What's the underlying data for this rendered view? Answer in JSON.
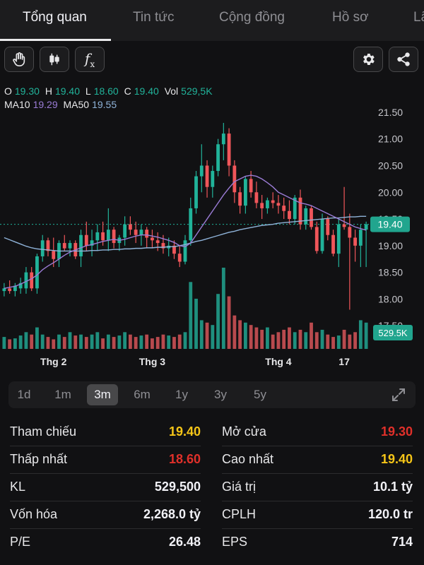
{
  "tabs": [
    {
      "label": "Tổng quan",
      "active": true
    },
    {
      "label": "Tin tức",
      "active": false
    },
    {
      "label": "Cộng đồng",
      "active": false
    },
    {
      "label": "Hồ sơ",
      "active": false
    },
    {
      "label": "Lã",
      "active": false
    }
  ],
  "toolbar": {
    "left_icons": [
      "hand-icon",
      "candlestick-icon",
      "function-fx-icon"
    ],
    "fx_glyph": "f",
    "fx_sub": "x",
    "right_icons": [
      "gear-icon",
      "share-icon"
    ]
  },
  "ohlc": {
    "o_label": "O",
    "o": "19.30",
    "h_label": "H",
    "h": "19.40",
    "l_label": "L",
    "l": "18.60",
    "c_label": "C",
    "c": "19.40",
    "vol_label": "Vol",
    "vol": "529,5K",
    "ma10_label": "MA10",
    "ma10": "19.29",
    "ma50_label": "MA50",
    "ma50": "19.55"
  },
  "chart_data": {
    "type": "candlestick",
    "y_ticks": [
      "21.50",
      "21.00",
      "20.50",
      "20.00",
      "19.50",
      "19.00",
      "18.50",
      "18.00",
      "17.50"
    ],
    "ylim": [
      17.45,
      21.75
    ],
    "x_labels": [
      "Thg 2",
      "Thg 3",
      "Thg 4",
      "17"
    ],
    "last_price_label": "19.40",
    "last_price": 19.4,
    "volume_label": "529.5K",
    "colors": {
      "up": "#21b39a",
      "down": "#f0565a",
      "ma10": "#9b7cd6",
      "ma50": "#8fb3d9",
      "volume_up": "#1f8f7e",
      "volume_down": "#b84a4e"
    },
    "candles": [
      {
        "o": 18.15,
        "h": 18.3,
        "l": 18.05,
        "c": 18.2,
        "v": 0.25
      },
      {
        "o": 18.2,
        "h": 18.35,
        "l": 18.1,
        "c": 18.15,
        "v": 0.2
      },
      {
        "o": 18.15,
        "h": 18.3,
        "l": 18.05,
        "c": 18.25,
        "v": 0.22
      },
      {
        "o": 18.2,
        "h": 18.4,
        "l": 18.1,
        "c": 18.3,
        "v": 0.28
      },
      {
        "o": 18.2,
        "h": 18.6,
        "l": 18.1,
        "c": 18.5,
        "v": 0.35
      },
      {
        "o": 18.5,
        "h": 18.6,
        "l": 18.15,
        "c": 18.2,
        "v": 0.3
      },
      {
        "o": 18.2,
        "h": 18.85,
        "l": 18.1,
        "c": 18.8,
        "v": 0.45
      },
      {
        "o": 18.8,
        "h": 19.2,
        "l": 18.7,
        "c": 19.1,
        "v": 0.3
      },
      {
        "o": 19.1,
        "h": 19.15,
        "l": 18.8,
        "c": 18.9,
        "v": 0.25
      },
      {
        "o": 18.9,
        "h": 19.15,
        "l": 18.6,
        "c": 18.75,
        "v": 0.2
      },
      {
        "o": 18.75,
        "h": 19.1,
        "l": 18.6,
        "c": 19.05,
        "v": 0.3
      },
      {
        "o": 19.05,
        "h": 19.2,
        "l": 18.9,
        "c": 18.95,
        "v": 0.25
      },
      {
        "o": 18.95,
        "h": 19.1,
        "l": 18.8,
        "c": 19.05,
        "v": 0.35
      },
      {
        "o": 19.05,
        "h": 19.1,
        "l": 18.75,
        "c": 18.8,
        "v": 0.28
      },
      {
        "o": 18.8,
        "h": 19.3,
        "l": 18.6,
        "c": 19.2,
        "v": 0.3
      },
      {
        "o": 19.2,
        "h": 19.45,
        "l": 18.9,
        "c": 19.0,
        "v": 0.25
      },
      {
        "o": 19.0,
        "h": 19.3,
        "l": 18.8,
        "c": 19.1,
        "v": 0.3
      },
      {
        "o": 19.1,
        "h": 19.4,
        "l": 18.9,
        "c": 19.25,
        "v": 0.35
      },
      {
        "o": 19.25,
        "h": 19.45,
        "l": 19.0,
        "c": 19.1,
        "v": 0.22
      },
      {
        "o": 19.1,
        "h": 19.7,
        "l": 18.9,
        "c": 19.3,
        "v": 0.3
      },
      {
        "o": 19.3,
        "h": 19.35,
        "l": 18.95,
        "c": 19.05,
        "v": 0.25
      },
      {
        "o": 19.05,
        "h": 19.2,
        "l": 18.9,
        "c": 19.15,
        "v": 0.28
      },
      {
        "o": 19.15,
        "h": 19.55,
        "l": 19.0,
        "c": 19.4,
        "v": 0.35
      },
      {
        "o": 19.4,
        "h": 19.55,
        "l": 19.2,
        "c": 19.3,
        "v": 0.3
      },
      {
        "o": 19.3,
        "h": 19.45,
        "l": 19.05,
        "c": 19.2,
        "v": 0.25
      },
      {
        "o": 19.2,
        "h": 19.4,
        "l": 19.0,
        "c": 19.3,
        "v": 0.28
      },
      {
        "o": 19.3,
        "h": 19.35,
        "l": 18.95,
        "c": 19.15,
        "v": 0.3
      },
      {
        "o": 19.15,
        "h": 19.3,
        "l": 18.95,
        "c": 19.1,
        "v": 0.22
      },
      {
        "o": 19.1,
        "h": 19.25,
        "l": 18.9,
        "c": 19.05,
        "v": 0.25
      },
      {
        "o": 19.05,
        "h": 19.2,
        "l": 18.85,
        "c": 18.95,
        "v": 0.3
      },
      {
        "o": 18.95,
        "h": 19.15,
        "l": 18.8,
        "c": 19.0,
        "v": 0.28
      },
      {
        "o": 19.0,
        "h": 19.1,
        "l": 18.75,
        "c": 18.85,
        "v": 0.25
      },
      {
        "o": 18.85,
        "h": 19.0,
        "l": 18.6,
        "c": 18.7,
        "v": 0.3
      },
      {
        "o": 18.7,
        "h": 19.2,
        "l": 18.65,
        "c": 19.1,
        "v": 0.35
      },
      {
        "o": 19.1,
        "h": 19.9,
        "l": 19.0,
        "c": 19.7,
        "v": 1.4
      },
      {
        "o": 19.7,
        "h": 20.4,
        "l": 19.6,
        "c": 20.3,
        "v": 1.05
      },
      {
        "o": 20.3,
        "h": 20.9,
        "l": 20.0,
        "c": 20.5,
        "v": 0.6
      },
      {
        "o": 20.5,
        "h": 20.6,
        "l": 19.9,
        "c": 20.1,
        "v": 0.55
      },
      {
        "o": 20.1,
        "h": 20.5,
        "l": 19.9,
        "c": 20.4,
        "v": 0.5
      },
      {
        "o": 20.4,
        "h": 21.0,
        "l": 20.3,
        "c": 20.9,
        "v": 1.15
      },
      {
        "o": 20.9,
        "h": 21.3,
        "l": 20.6,
        "c": 21.1,
        "v": 1.7
      },
      {
        "o": 21.1,
        "h": 21.2,
        "l": 20.3,
        "c": 20.5,
        "v": 1.1
      },
      {
        "o": 20.5,
        "h": 20.6,
        "l": 19.8,
        "c": 20.0,
        "v": 0.7
      },
      {
        "o": 20.0,
        "h": 20.1,
        "l": 19.6,
        "c": 19.75,
        "v": 0.6
      },
      {
        "o": 19.75,
        "h": 20.3,
        "l": 19.6,
        "c": 20.25,
        "v": 0.55
      },
      {
        "o": 20.25,
        "h": 20.4,
        "l": 19.9,
        "c": 20.0,
        "v": 0.5
      },
      {
        "o": 20.0,
        "h": 20.2,
        "l": 19.7,
        "c": 19.8,
        "v": 0.45
      },
      {
        "o": 19.8,
        "h": 19.95,
        "l": 19.5,
        "c": 19.7,
        "v": 0.4
      },
      {
        "o": 19.7,
        "h": 19.9,
        "l": 19.6,
        "c": 19.85,
        "v": 0.45
      },
      {
        "o": 19.85,
        "h": 20.0,
        "l": 19.7,
        "c": 19.8,
        "v": 0.3
      },
      {
        "o": 19.8,
        "h": 19.95,
        "l": 19.6,
        "c": 19.75,
        "v": 0.35
      },
      {
        "o": 19.75,
        "h": 19.9,
        "l": 19.5,
        "c": 19.65,
        "v": 0.4
      },
      {
        "o": 19.65,
        "h": 19.85,
        "l": 19.4,
        "c": 19.5,
        "v": 0.45
      },
      {
        "o": 19.5,
        "h": 19.95,
        "l": 19.4,
        "c": 19.9,
        "v": 0.35
      },
      {
        "o": 19.9,
        "h": 20.05,
        "l": 19.3,
        "c": 19.4,
        "v": 0.4
      },
      {
        "o": 19.4,
        "h": 19.75,
        "l": 19.3,
        "c": 19.7,
        "v": 0.35
      },
      {
        "o": 19.7,
        "h": 19.75,
        "l": 19.3,
        "c": 19.35,
        "v": 0.55
      },
      {
        "o": 19.35,
        "h": 19.45,
        "l": 18.85,
        "c": 18.9,
        "v": 0.35
      },
      {
        "o": 18.9,
        "h": 19.6,
        "l": 18.85,
        "c": 19.5,
        "v": 0.4
      },
      {
        "o": 19.5,
        "h": 19.55,
        "l": 19.1,
        "c": 19.2,
        "v": 0.3
      },
      {
        "o": 19.2,
        "h": 19.3,
        "l": 18.8,
        "c": 18.85,
        "v": 0.25
      },
      {
        "o": 18.85,
        "h": 19.5,
        "l": 18.6,
        "c": 19.4,
        "v": 0.28
      },
      {
        "o": 19.4,
        "h": 20.1,
        "l": 19.3,
        "c": 19.35,
        "v": 0.4
      },
      {
        "o": 19.35,
        "h": 19.6,
        "l": 17.8,
        "c": 19.15,
        "v": 0.3
      },
      {
        "o": 19.15,
        "h": 19.3,
        "l": 18.7,
        "c": 19.0,
        "v": 0.35
      },
      {
        "o": 19.0,
        "h": 19.4,
        "l": 18.6,
        "c": 19.3,
        "v": 0.6
      },
      {
        "o": 19.3,
        "h": 19.45,
        "l": 18.6,
        "c": 19.4,
        "v": 0.55
      }
    ],
    "ma10": [
      18.2,
      18.22,
      18.24,
      18.28,
      18.33,
      18.38,
      18.45,
      18.55,
      18.62,
      18.68,
      18.75,
      18.82,
      18.88,
      18.92,
      18.96,
      19.0,
      19.02,
      19.05,
      19.08,
      19.1,
      19.12,
      19.1,
      19.12,
      19.15,
      19.18,
      19.2,
      19.2,
      19.18,
      19.16,
      19.13,
      19.1,
      19.06,
      19.0,
      18.98,
      19.05,
      19.2,
      19.35,
      19.5,
      19.65,
      19.8,
      19.95,
      20.08,
      20.2,
      20.25,
      20.3,
      20.32,
      20.3,
      20.25,
      20.18,
      20.1,
      20.0,
      19.95,
      19.9,
      19.85,
      19.8,
      19.78,
      19.75,
      19.7,
      19.65,
      19.6,
      19.55,
      19.5,
      19.45,
      19.4,
      19.35,
      19.32,
      19.29
    ],
    "ma50": [
      19.15,
      19.11,
      19.07,
      19.03,
      18.99,
      18.96,
      18.94,
      18.93,
      18.92,
      18.91,
      18.9,
      18.9,
      18.9,
      18.9,
      18.9,
      18.9,
      18.91,
      18.91,
      18.92,
      18.92,
      18.93,
      18.93,
      18.94,
      18.94,
      18.95,
      18.95,
      18.96,
      18.96,
      18.97,
      18.97,
      18.98,
      18.98,
      19.0,
      19.02,
      19.05,
      19.08,
      19.1,
      19.13,
      19.16,
      19.19,
      19.22,
      19.25,
      19.27,
      19.3,
      19.32,
      19.34,
      19.36,
      19.38,
      19.39,
      19.4,
      19.42,
      19.43,
      19.44,
      19.45,
      19.46,
      19.47,
      19.48,
      19.49,
      19.5,
      19.51,
      19.52,
      19.52,
      19.53,
      19.54,
      19.54,
      19.55,
      19.55
    ]
  },
  "ranges": {
    "items": [
      "1d",
      "1m",
      "3m",
      "6m",
      "1y",
      "3y",
      "5y"
    ],
    "active": "3m",
    "expand_icon": "expand-icon"
  },
  "stats": {
    "left": [
      {
        "label": "Tham chiếu",
        "value": "19.40",
        "color": "yellow"
      },
      {
        "label": "Thấp nhất",
        "value": "18.60",
        "color": "red"
      },
      {
        "label": "KL",
        "value": "529,500",
        "color": ""
      },
      {
        "label": "Vốn hóa",
        "value": "2,268.0 tỷ",
        "color": ""
      },
      {
        "label": "P/E",
        "value": "26.48",
        "color": ""
      }
    ],
    "right": [
      {
        "label": "Mở cửa",
        "value": "19.30",
        "color": "red"
      },
      {
        "label": "Cao nhất",
        "value": "19.40",
        "color": "yellow"
      },
      {
        "label": "Giá trị",
        "value": "10.1 tỷ",
        "color": ""
      },
      {
        "label": "CPLH",
        "value": "120.0 tr",
        "color": ""
      },
      {
        "label": "EPS",
        "value": "714",
        "color": ""
      }
    ]
  }
}
